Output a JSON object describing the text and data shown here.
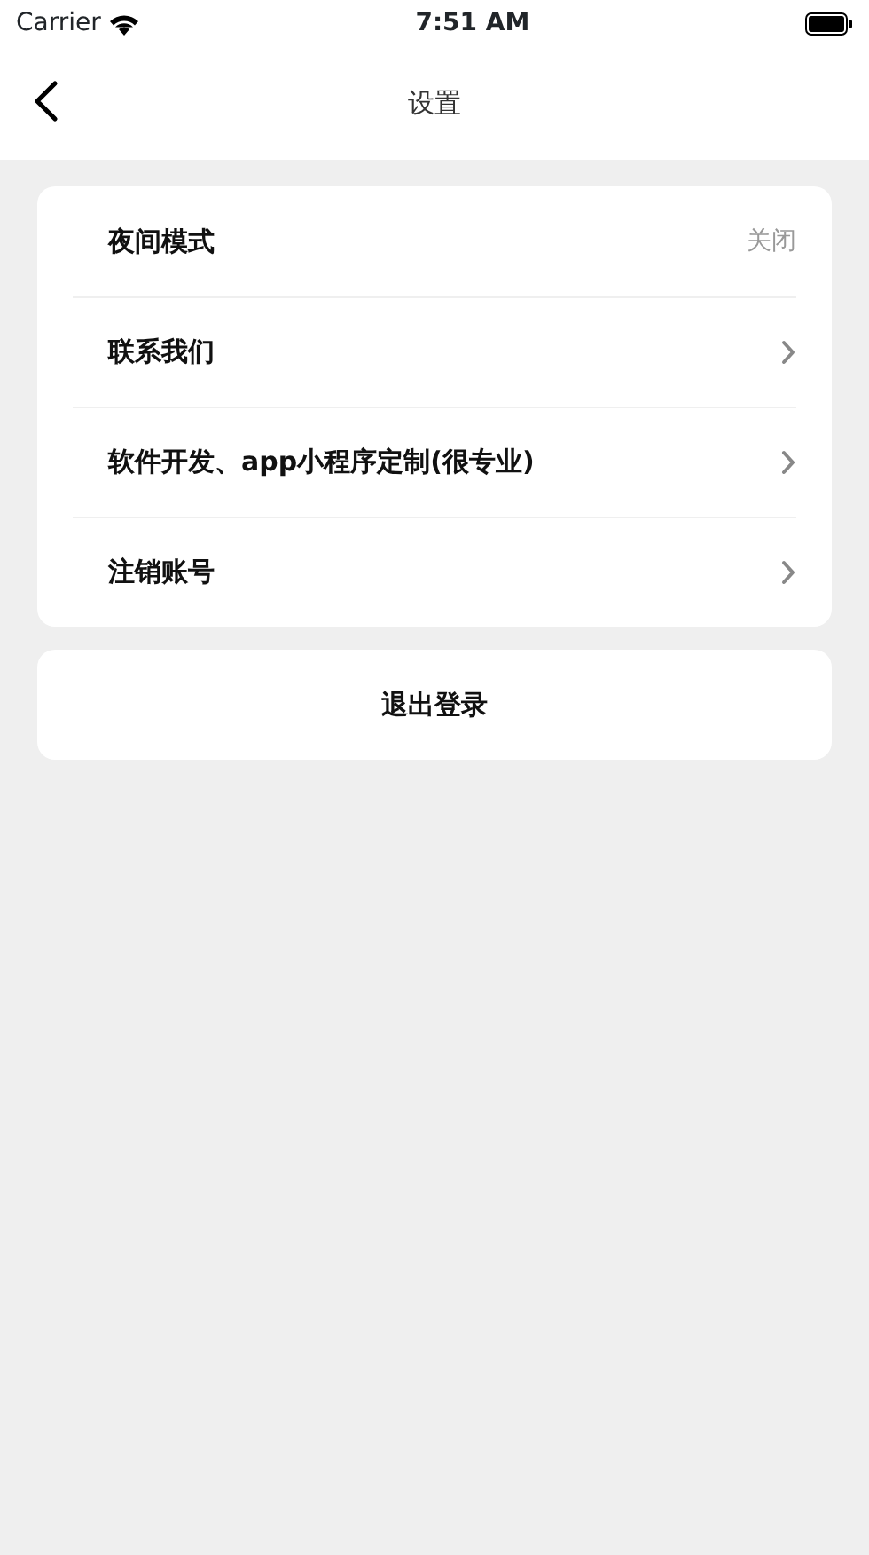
{
  "status_bar": {
    "carrier": "Carrier",
    "time": "7:51 AM"
  },
  "header": {
    "title": "设置"
  },
  "settings": [
    {
      "kind": "value",
      "label": "夜间模式",
      "value": "关闭"
    },
    {
      "kind": "link",
      "label": "联系我们"
    },
    {
      "kind": "link",
      "label": "软件开发、app小程序定制(很专业)"
    },
    {
      "kind": "link",
      "label": "注销账号"
    }
  ],
  "logout_button": "退出登录"
}
